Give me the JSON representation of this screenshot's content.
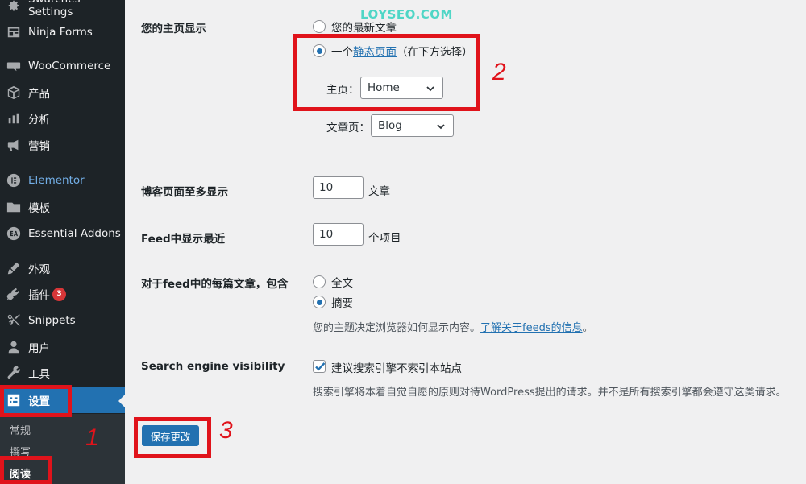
{
  "sidebar": {
    "items": [
      {
        "key": "swatches",
        "label": "Swatches Settings",
        "icon": "gear-icon"
      },
      {
        "key": "ninja",
        "label": "Ninja Forms",
        "icon": "forms-icon"
      },
      {
        "key": "woo",
        "label": "WooCommerce",
        "icon": "woocommerce-icon"
      },
      {
        "key": "products",
        "label": "产品",
        "icon": "box-icon"
      },
      {
        "key": "analytics",
        "label": "分析",
        "icon": "bar-chart-icon"
      },
      {
        "key": "marketing",
        "label": "营销",
        "icon": "megaphone-icon"
      },
      {
        "key": "elementor",
        "label": "Elementor",
        "icon": "elementor-icon"
      },
      {
        "key": "templates",
        "label": "模板",
        "icon": "folder-icon"
      },
      {
        "key": "essential",
        "label": "Essential Addons",
        "icon": "essential-addons-icon"
      },
      {
        "key": "appearance",
        "label": "外观",
        "icon": "paintbrush-icon"
      },
      {
        "key": "plugins",
        "label": "插件",
        "icon": "plugin-icon",
        "badge": "3"
      },
      {
        "key": "snippets",
        "label": "Snippets",
        "icon": "scissors-icon"
      },
      {
        "key": "users",
        "label": "用户",
        "icon": "user-icon"
      },
      {
        "key": "tools",
        "label": "工具",
        "icon": "wrench-icon"
      },
      {
        "key": "settings",
        "label": "设置",
        "icon": "settings-icon"
      }
    ],
    "submenu": [
      {
        "label": "常规"
      },
      {
        "label": "撰写"
      },
      {
        "label": "阅读"
      }
    ]
  },
  "form": {
    "homepage": {
      "label": "您的主页显示",
      "option_latest": "您的最新文章",
      "option_static_prefix": "一个",
      "option_static_link": "静态页面",
      "option_static_suffix": "（在下方选择）",
      "home_label": "主页：",
      "home_value": "Home",
      "posts_label": "文章页：",
      "posts_value": "Blog"
    },
    "blog_pages": {
      "label": "博客页面至多显示",
      "value": "10",
      "unit": "文章"
    },
    "feed_recent": {
      "label": "Feed中显示最近",
      "value": "10",
      "unit": "个项目"
    },
    "feed_each": {
      "label": "对于feed中的每篇文章，包含",
      "option_full": "全文",
      "option_summary": "摘要",
      "desc_prefix": "您的主题决定浏览器如何显示内容。",
      "desc_link": "了解关于feeds的信息",
      "desc_suffix": "。"
    },
    "search": {
      "label": "Search engine visibility",
      "checkbox_label": "建议搜索引擎不索引本站点",
      "desc": "搜索引擎将本着自觉自愿的原则对待WordPress提出的请求。并不是所有搜索引擎都会遵守这类请求。"
    },
    "save_label": "保存更改"
  },
  "annotations": {
    "n1": "1",
    "n2": "2",
    "n3": "3",
    "watermark": "LOYSEO.COM"
  },
  "colors": {
    "accent": "#2271b1",
    "sidebar_bg": "#1d2327",
    "annotation": "#e0131b"
  }
}
